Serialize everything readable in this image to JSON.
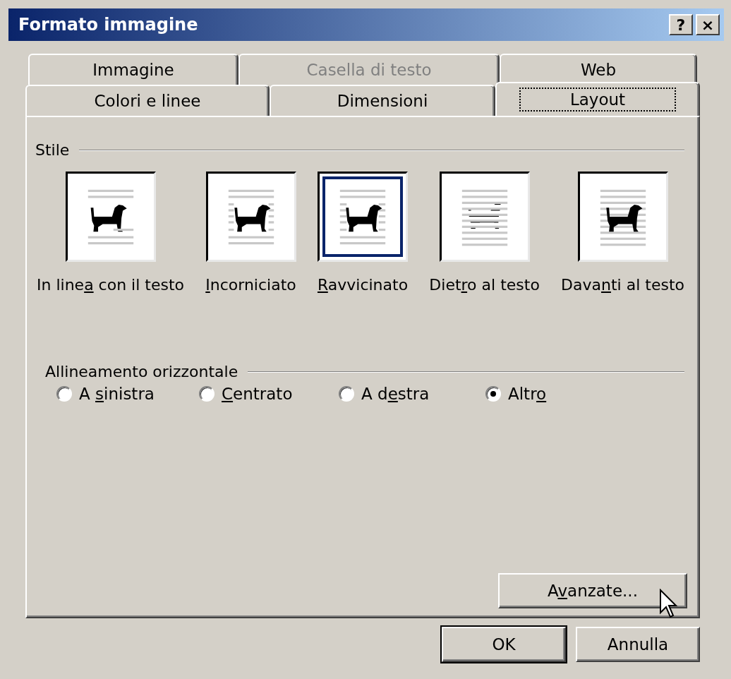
{
  "window": {
    "title": "Formato immagine",
    "title_buttons": [
      "?",
      "×"
    ]
  },
  "tabs_back": [
    {
      "label": "Immagine",
      "selected": false,
      "disabled": false
    },
    {
      "label": "Casella di testo",
      "selected": false,
      "disabled": true
    },
    {
      "label": "Web",
      "selected": false,
      "disabled": false
    }
  ],
  "tabs_front": [
    {
      "label": "Colori e linee",
      "selected": false,
      "disabled": false
    },
    {
      "label": "Dimensioni",
      "selected": false,
      "disabled": false
    },
    {
      "label": "Layout",
      "selected": true,
      "disabled": false
    }
  ],
  "style_group": {
    "title": "Stile",
    "options": [
      {
        "kind": "inline",
        "selected": false,
        "label": {
          "before": "In line",
          "key": "a",
          "after": " con il testo"
        }
      },
      {
        "kind": "square",
        "selected": false,
        "label": {
          "key": "I",
          "after": "ncorniciato"
        }
      },
      {
        "kind": "tight",
        "selected": true,
        "label": {
          "key": "R",
          "after": "avvicinato"
        }
      },
      {
        "kind": "behind",
        "selected": false,
        "label": {
          "before": "Diet",
          "key": "r",
          "after": "o al testo"
        }
      },
      {
        "kind": "front",
        "selected": false,
        "label": {
          "before": "Dava",
          "key": "n",
          "after": "ti al testo"
        }
      }
    ]
  },
  "alignment_group": {
    "title": "Allineamento orizzontale",
    "options": [
      {
        "selected": false,
        "label": {
          "before": "A ",
          "key": "s",
          "after": "inistra"
        }
      },
      {
        "selected": false,
        "label": {
          "key": "C",
          "after": "entrato"
        }
      },
      {
        "selected": false,
        "label": {
          "before": "A d",
          "key": "e",
          "after": "stra"
        }
      },
      {
        "selected": true,
        "label": {
          "before": "Altr",
          "key": "o"
        }
      }
    ]
  },
  "advanced_button": {
    "label": {
      "before": "A",
      "key": "v",
      "after": "anzate..."
    },
    "default": false
  },
  "buttons": [
    {
      "label": {
        "before": "OK"
      },
      "default": true
    },
    {
      "label": {
        "before": "Annulla"
      },
      "default": false
    }
  ]
}
